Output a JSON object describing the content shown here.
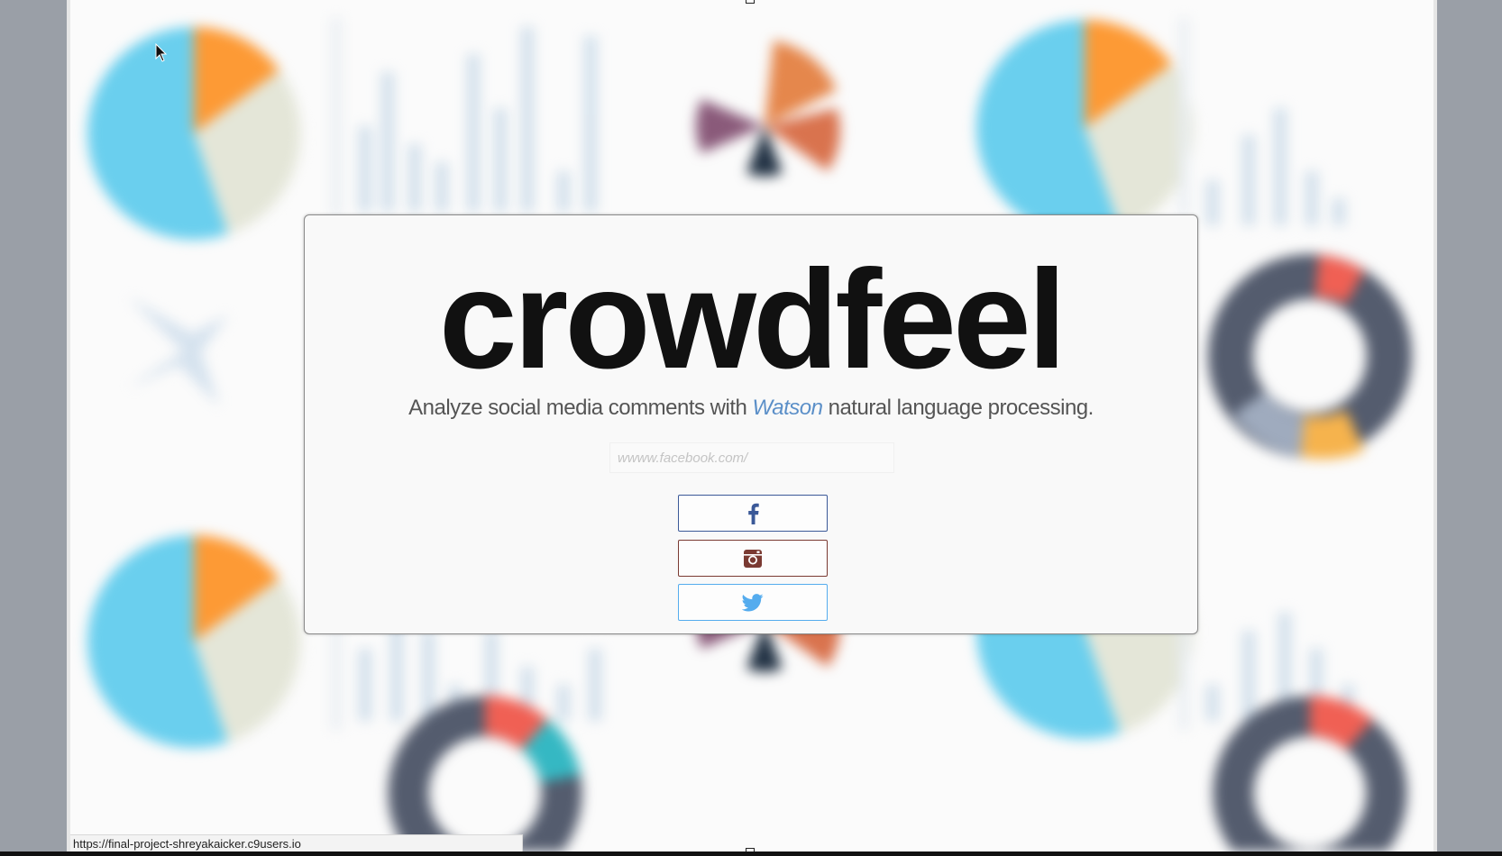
{
  "app": {
    "brand": "crowdfeel",
    "tagline_before": "Analyze social media comments with ",
    "tagline_highlight": "Watson",
    "tagline_after": " natural language processing."
  },
  "search": {
    "placeholder": "wwww.facebook.com/",
    "value": ""
  },
  "buttons": {
    "facebook": {
      "icon": "facebook-icon",
      "color": "#3b5998"
    },
    "instagram": {
      "icon": "instagram-icon",
      "color": "#7a3a32"
    },
    "twitter": {
      "icon": "twitter-icon",
      "color": "#55acee"
    }
  },
  "status_bar": {
    "link_url": "https://final-project-shreyakaicker.c9users.io"
  },
  "colors": {
    "accent_watson": "#5b8fc8",
    "brand_text": "#111111"
  }
}
